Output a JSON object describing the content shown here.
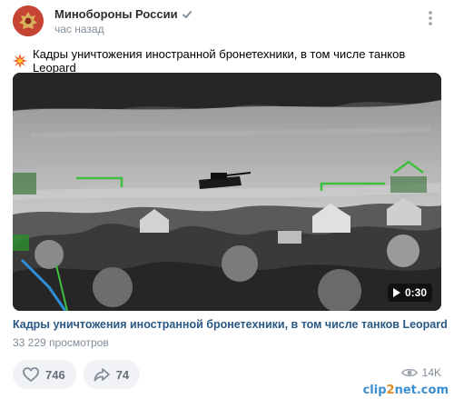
{
  "author": {
    "name": "Минобороны России",
    "time": "час назад"
  },
  "post": {
    "text": "Кадры уничтожения иностранной бронетехники, в том числе танков Leopard",
    "emoji_icon": "collision-icon"
  },
  "video": {
    "duration": "0:30",
    "title": "Кадры уничтожения иностранной бронетехники, в том числе танков Leopard",
    "views": "33 229 просмотров"
  },
  "actions": {
    "likes": "746",
    "shares": "74",
    "views": "14K"
  },
  "watermark": {
    "prefix": "clip",
    "accent": "2",
    "suffix": "net.com"
  },
  "colors": {
    "link": "#2a5885",
    "muted": "#818c99",
    "action_bg": "#f0f2f5"
  }
}
